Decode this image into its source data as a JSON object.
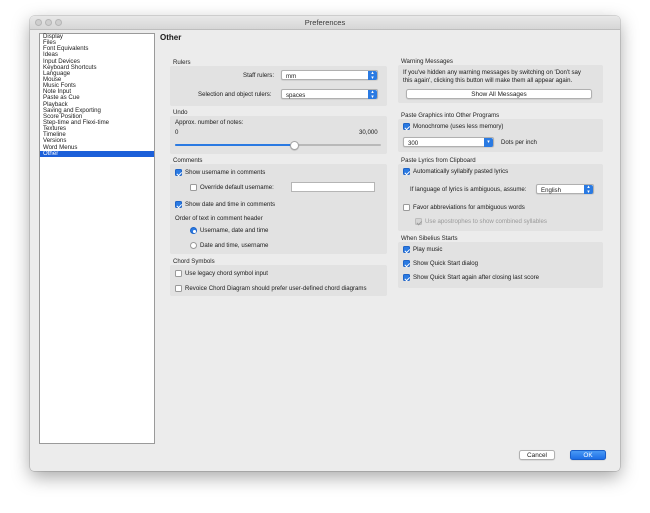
{
  "window": {
    "title": "Preferences"
  },
  "sidebar": {
    "items": [
      "Display",
      "Files",
      "Font Equivalents",
      "Ideas",
      "Input Devices",
      "Keyboard Shortcuts",
      "Language",
      "Mouse",
      "Music Fonts",
      "Note Input",
      "Paste as Cue",
      "Playback",
      "Saving and Exporting",
      "Score Position",
      "Step-time and Flexi-time",
      "Textures",
      "Timeline",
      "Versions",
      "Word Menus",
      "Other"
    ],
    "selected_index": 19
  },
  "page_heading": "Other",
  "rulers": {
    "title": "Rulers",
    "staff_label": "Staff rulers:",
    "staff_value": "mm",
    "selection_label": "Selection and object rulers:",
    "selection_value": "spaces"
  },
  "undo": {
    "title": "Undo",
    "approx_label": "Approx. number of notes:",
    "min_label": "0",
    "max_label": "30,000",
    "slider_fraction": 0.58
  },
  "comments": {
    "title": "Comments",
    "show_username": {
      "label": "Show username in comments",
      "checked": true
    },
    "override_username": {
      "label": "Override default username:",
      "checked": false,
      "value": ""
    },
    "show_datetime": {
      "label": "Show date and time in comments",
      "checked": true
    },
    "order_label": "Order of text in comment header",
    "order_options": [
      {
        "label": "Username, date and time",
        "selected": true
      },
      {
        "label": "Date and time, username",
        "selected": false
      }
    ]
  },
  "chord_symbols": {
    "title": "Chord Symbols",
    "legacy": {
      "label": "Use legacy chord symbol input",
      "checked": false
    },
    "revoice": {
      "label": "Revoice Chord Diagram should prefer user-defined chord diagrams",
      "checked": false
    }
  },
  "warning_messages": {
    "title": "Warning Messages",
    "description_line1": "If you've hidden any warning messages by switching on 'Don't say",
    "description_line2": "this again', clicking this button will make them all appear again.",
    "button_label": "Show All Messages"
  },
  "paste_graphics": {
    "title": "Paste Graphics into Other Programs",
    "monochrome": {
      "label": "Monochrome (uses less memory)",
      "checked": true
    },
    "dpi_value": "300",
    "dpi_label": "Dots per inch"
  },
  "paste_lyrics": {
    "title": "Paste Lyrics from Clipboard",
    "auto_syllabify": {
      "label": "Automatically syllabify pasted lyrics",
      "checked": true
    },
    "language_label": "If language of lyrics is ambiguous, assume:",
    "language_value": "English",
    "favor_abbrev": {
      "label": "Favor abbreviations for ambiguous words",
      "checked": false
    },
    "apostrophes": {
      "label": "Use apostrophes to show combined syllables",
      "checked": true,
      "disabled": true
    }
  },
  "when_starts": {
    "title": "When Sibelius Starts",
    "play_music": {
      "label": "Play music",
      "checked": true
    },
    "show_quick_start": {
      "label": "Show Quick Start dialog",
      "checked": true
    },
    "show_quick_start_again": {
      "label": "Show Quick Start again after closing last score",
      "checked": true
    }
  },
  "footer": {
    "cancel_label": "Cancel",
    "ok_label": "OK"
  },
  "colors": {
    "accent": "#2a7ae2",
    "selection": "#1b5fd9"
  }
}
